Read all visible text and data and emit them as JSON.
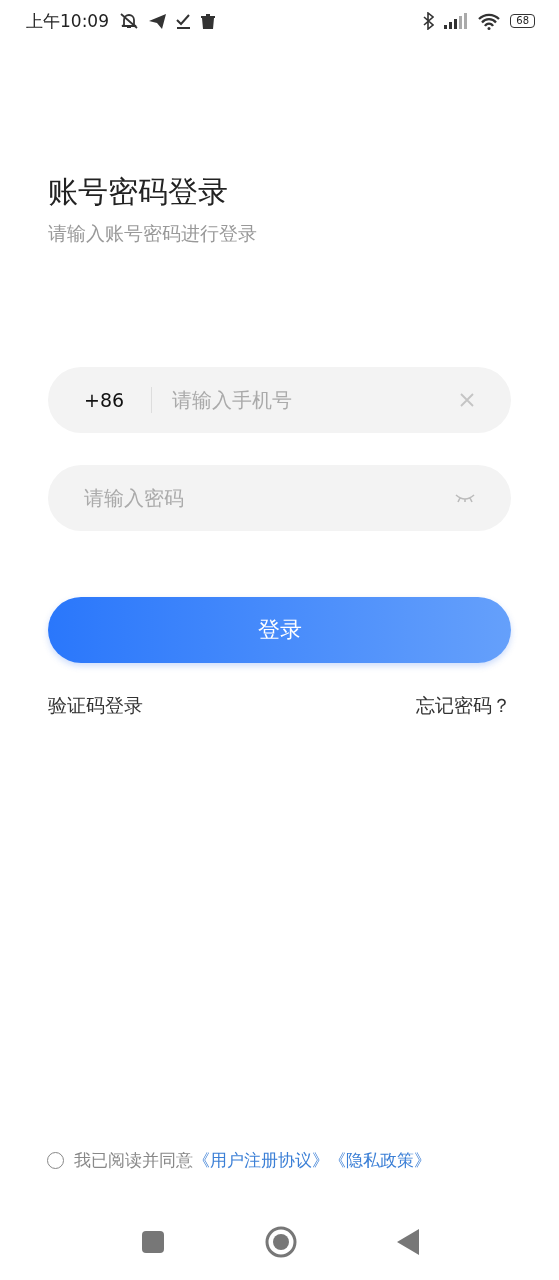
{
  "status_bar": {
    "time": "上午10:09",
    "battery": "68"
  },
  "header": {
    "title": "账号密码登录",
    "subtitle": "请输入账号密码进行登录"
  },
  "phone_field": {
    "country_code": "+86",
    "placeholder": "请输入手机号"
  },
  "password_field": {
    "placeholder": "请输入密码"
  },
  "login_button": "登录",
  "links": [
    "验证码登录",
    "忘记密码？"
  ],
  "agreement": {
    "checked": false,
    "text": "我已阅读并同意",
    "links": [
      "《用户注册协议》",
      "《隐私政策》"
    ]
  }
}
